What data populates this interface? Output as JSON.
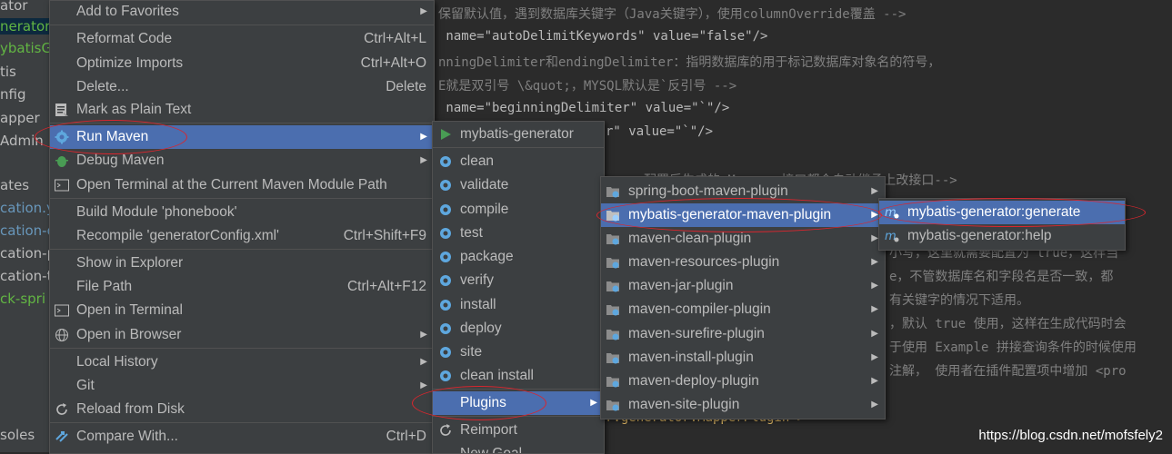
{
  "project_panel": {
    "items": [
      "ator",
      "nerator",
      "ybatisGe",
      "tis",
      "nfig",
      "apper",
      "Admin",
      "ates",
      "cation.y",
      "cation-d",
      "cation-p",
      "cation-te",
      "ck-spri",
      "soles"
    ]
  },
  "editor": {
    "lines": [
      {
        "t": "保留默认值，遇到数据库关键字（Java关键字），使用columnOverride覆盖 -->"
      },
      {
        "t": " name=\"autoDelimitKeywords\" value=\"false\"/>"
      },
      {
        "t": "nningDelimiter和endingDelimiter：指明数据库的用于标记数据库对象名的符号，"
      },
      {
        "t": "E就是双引号 \\&quot;，MYSQL默认是`反引号 -->"
      },
      {
        "t": " name=\"beginningDelimiter\" value=\"`\"/>"
      },
      {
        "t": "r\" value=\"`\"/>"
      },
      {
        "t": "配置后生成的 Mapper 接口都会自动继承上改接口-->"
      },
      {
        "t": "小写，这里就需要配置为 true，这样当"
      },
      {
        "t": "e，不管数据库名和字段名是否一致，都"
      },
      {
        "t": "有关键字的情况下适用。"
      },
      {
        "t": "，默认 true 使用，这样在生成代码时会"
      },
      {
        "t": "于使用 Example 拼接查询条件的时候使用"
      },
      {
        "t": "注解， 使用者在插件配置项中增加 <pro"
      },
      {
        "t": "r.generator.MapperPlugin\">"
      }
    ]
  },
  "context_menu": {
    "items": [
      {
        "label": "Add to Favorites",
        "shortcut": "",
        "arrow": true
      },
      {
        "label": "Reformat Code",
        "shortcut": "Ctrl+Alt+L"
      },
      {
        "label": "Optimize Imports",
        "shortcut": "Ctrl+Alt+O"
      },
      {
        "label": "Delete...",
        "shortcut": "Delete"
      },
      {
        "label": "Mark as Plain Text",
        "shortcut": ""
      },
      {
        "label": "Run Maven",
        "shortcut": "",
        "arrow": true
      },
      {
        "label": "Debug Maven",
        "shortcut": "",
        "arrow": true
      },
      {
        "label": "Open Terminal at the Current Maven Module Path",
        "shortcut": ""
      },
      {
        "label": "Build Module 'phonebook'",
        "shortcut": ""
      },
      {
        "label": "Recompile 'generatorConfig.xml'",
        "shortcut": "Ctrl+Shift+F9"
      },
      {
        "label": "Show in Explorer",
        "shortcut": ""
      },
      {
        "label": "File Path",
        "shortcut": "Ctrl+Alt+F12"
      },
      {
        "label": "Open in Terminal",
        "shortcut": ""
      },
      {
        "label": "Open in Browser",
        "shortcut": "",
        "arrow": true
      },
      {
        "label": "Local History",
        "shortcut": "",
        "arrow": true
      },
      {
        "label": "Git",
        "shortcut": "",
        "arrow": true
      },
      {
        "label": "Reload from Disk",
        "shortcut": ""
      },
      {
        "label": "Compare With...",
        "shortcut": "Ctrl+D"
      }
    ]
  },
  "run_maven_menu": {
    "items": [
      {
        "label": "mybatis-generator"
      },
      {
        "label": "clean"
      },
      {
        "label": "validate"
      },
      {
        "label": "compile"
      },
      {
        "label": "test"
      },
      {
        "label": "package"
      },
      {
        "label": "verify"
      },
      {
        "label": "install"
      },
      {
        "label": "deploy"
      },
      {
        "label": "site"
      },
      {
        "label": "clean install"
      },
      {
        "label": "Plugins"
      },
      {
        "label": "Reimport"
      },
      {
        "label": "New Goal..."
      }
    ]
  },
  "plugins_menu": {
    "items": [
      {
        "label": "spring-boot-maven-plugin"
      },
      {
        "label": "mybatis-generator-maven-plugin"
      },
      {
        "label": "maven-clean-plugin"
      },
      {
        "label": "maven-resources-plugin"
      },
      {
        "label": "maven-jar-plugin"
      },
      {
        "label": "maven-compiler-plugin"
      },
      {
        "label": "maven-surefire-plugin"
      },
      {
        "label": "maven-install-plugin"
      },
      {
        "label": "maven-deploy-plugin"
      },
      {
        "label": "maven-site-plugin"
      }
    ]
  },
  "goals_menu": {
    "items": [
      {
        "label": "mybatis-generator:generate"
      },
      {
        "label": "mybatis-generator:help"
      }
    ]
  },
  "watermark": "https://blog.csdn.net/mofsfely2",
  "colors": {
    "menu_bg": "#3c3f41",
    "highlight": "#4b6eaf",
    "annotation": "#d9262e"
  }
}
